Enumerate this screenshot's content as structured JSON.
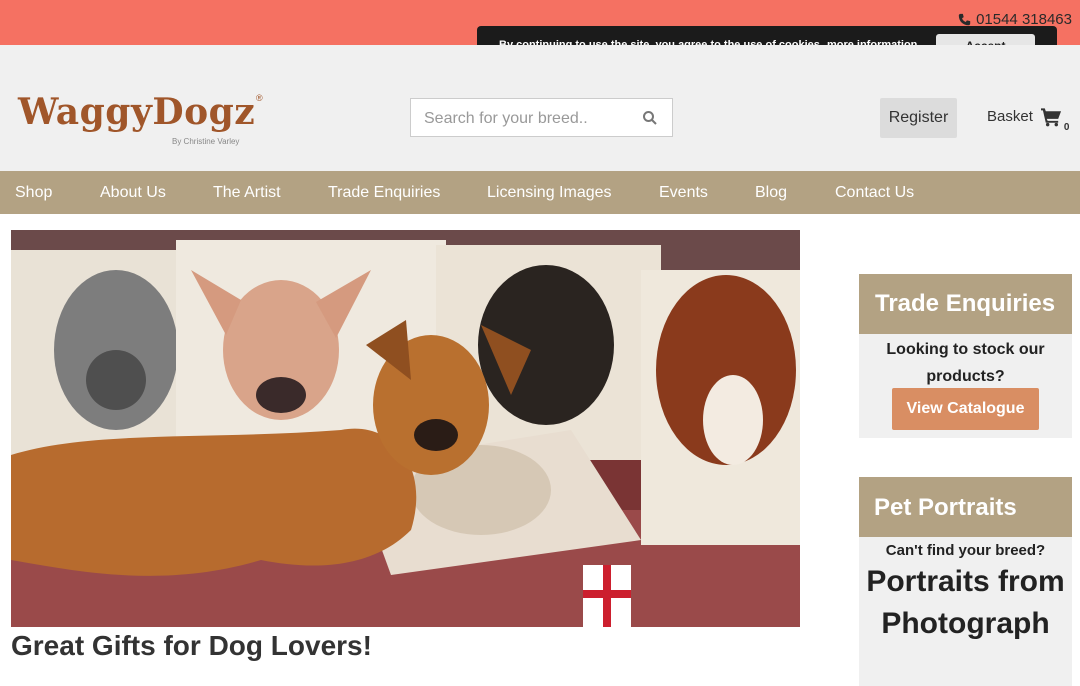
{
  "topbar": {
    "phone": "01544 318463",
    "phone_icon": "phone-icon",
    "color": "#f57162"
  },
  "cookie_notice": {
    "message": "By continuing to use the site, you agree to the use of cookies.",
    "link": "more information",
    "accept_label": "Accept"
  },
  "header": {
    "logo_text": "WaggyDogz",
    "logo_tm": "®",
    "logo_byline": "By Christine Varley",
    "search_placeholder": "Search for your breed..",
    "search_icon": "search-icon",
    "register_label": "Register",
    "basket_label": "Basket",
    "basket_count": "0",
    "basket_icon": "cart-icon"
  },
  "nav": {
    "color": "#b3a283",
    "items": [
      "Shop",
      "About Us",
      "The Artist",
      "Trade Enquiries",
      "Licensing Images",
      "Events",
      "Blog",
      "Contact Us"
    ]
  },
  "main": {
    "title": "Great Gifts for Dog Lovers!"
  },
  "sidebar": {
    "trade": {
      "title": "Trade Enquiries",
      "text": "Looking to stock our products?",
      "button": "View Catalogue",
      "button_color": "#d98e63"
    },
    "portraits": {
      "title": "Pet Portraits",
      "question": "Can't find your breed?",
      "headline": "Portraits from Photograph"
    }
  }
}
